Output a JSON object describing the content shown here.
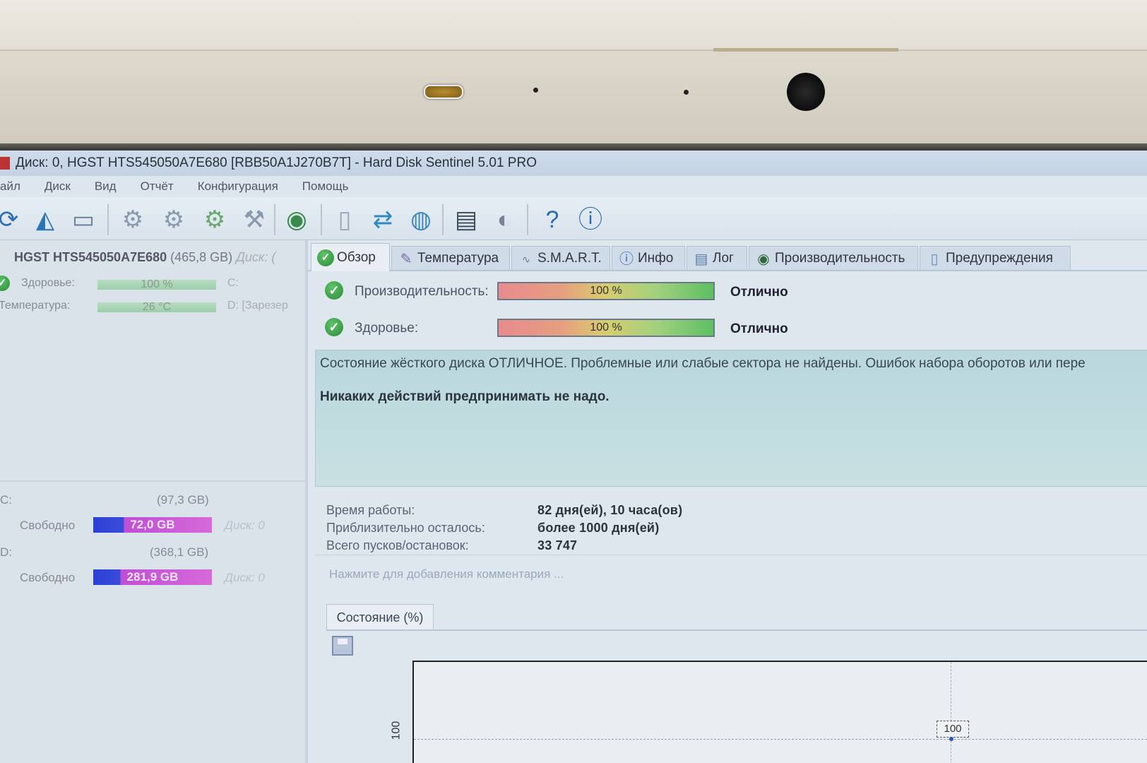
{
  "window": {
    "title": "Диск: 0, HGST HTS545050A7E680 [RBB50A1J270B7T]  -  Hard Disk Sentinel 5.01 PRO"
  },
  "menu": [
    "айл",
    "Диск",
    "Вид",
    "Отчёт",
    "Конфигурация",
    "Помощь"
  ],
  "left_panel": {
    "disk_name": "HGST HTS545050A7E680",
    "disk_size": "(465,8 GB)",
    "disk_ref": "Диск: (",
    "health_label": "Здоровье:",
    "health_value": "100 %",
    "health_drive": "C:",
    "temp_label": "Температура:",
    "temp_value": "26 °C",
    "temp_drive": "D:  [Зарезер",
    "drives": [
      {
        "letter": "C:",
        "size": "(97,3 GB)",
        "free_label": "Свободно",
        "free": "72,0 GB",
        "free_fraction": 0.74,
        "disk_ref": "Диск: 0"
      },
      {
        "letter": "D:",
        "size": "(368,1 GB)",
        "free_label": "Свободно",
        "free": "281,9 GB",
        "free_fraction": 0.77,
        "disk_ref": "Диск: 0"
      }
    ]
  },
  "tabs": [
    {
      "label": "Обзор",
      "icon": "check-icon",
      "active": true
    },
    {
      "label": "Температура",
      "icon": "thermometer-icon"
    },
    {
      "label": "S.M.A.R.T.",
      "icon": "smart-icon"
    },
    {
      "label": "Инфо",
      "icon": "info-icon"
    },
    {
      "label": "Лог",
      "icon": "log-icon"
    },
    {
      "label": "Производительность",
      "icon": "gauge-icon"
    },
    {
      "label": "Предупреждения",
      "icon": "document-icon"
    }
  ],
  "overview": {
    "performance_label": "Производительность:",
    "performance_value": "100 %",
    "performance_percent": 100,
    "performance_status": "Отлично",
    "health_label": "Здоровье:",
    "health_value": "100 %",
    "health_percent": 100,
    "health_status": "Отлично",
    "status_text": "Состояние жёсткого диска ОТЛИЧНОЕ. Проблемные или слабые сектора не найдены. Ошибок набора оборотов или пере",
    "advice": "Никаких действий предпринимать не надо.",
    "uptime_label": "Время работы:",
    "uptime_value": "82 дня(ей), 10 часа(ов)",
    "remaining_label": "Приблизительно осталось:",
    "remaining_value": "более 1000 дня(ей)",
    "starts_label": "Всего пусков/остановок:",
    "starts_value": "33 747",
    "comment_placeholder": "Нажмите для добавления комментария ...",
    "subtab": "Состояние (%)"
  },
  "chart_data": {
    "type": "line",
    "title": "",
    "xlabel": "",
    "ylabel": "",
    "y_ticks": [
      "100"
    ],
    "series": [
      {
        "values": [
          100
        ]
      }
    ],
    "point_labels": [
      "100"
    ]
  }
}
